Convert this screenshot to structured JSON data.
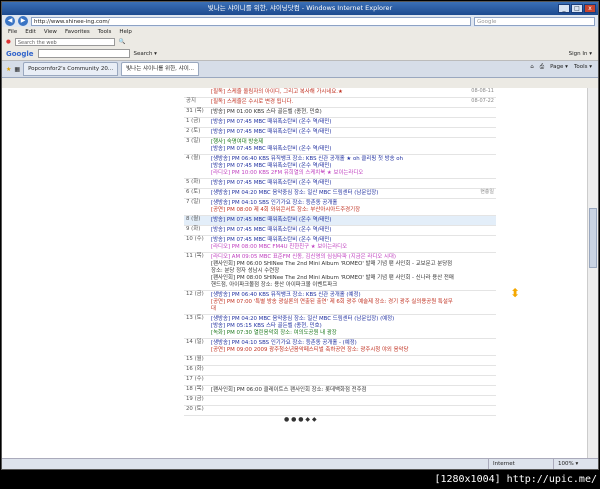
{
  "window": {
    "title": "빛나는 샤이니를 위한, 샤이닝닷컴 - Windows Internet Explorer",
    "controls": [
      "_",
      "□",
      "x"
    ]
  },
  "address": {
    "url": "http://www.shinee-ing.com/",
    "search_placeholder": "Google"
  },
  "menu": [
    "File",
    "Edit",
    "View",
    "Favorites",
    "Tools",
    "Help"
  ],
  "links_bar": {
    "search_placeholder": "Search the web"
  },
  "google_bar": {
    "logo": "Google",
    "search_label": "Search ▾",
    "sign_in": "Sign In ▾"
  },
  "tabs": [
    {
      "label": "Popcornfor2's Community 20..."
    },
    {
      "label": "빛나는 샤이니를 위한, 샤이..."
    }
  ],
  "tab_tools": [
    "Page ▾",
    "Tools ▾"
  ],
  "calendar": {
    "rows": [
      {
        "day": "",
        "events": [
          {
            "text": "[필독] 스케줄 올림자의 아이디, 그리고 복사해 가시네요.★",
            "cls": "ev-r"
          }
        ],
        "right": "08-08-11"
      },
      {
        "day": "공지",
        "events": [
          {
            "text": "[필독] 스케줄은 수시로 변경 됩니다.",
            "cls": "ev-r"
          }
        ],
        "right": "08-07-22"
      },
      {
        "day": "31 (목)",
        "events": [
          {
            "text": "[방송] PM 01:00 KBS 스타 골든벨 (종현, 민호)",
            "cls": "ev-k"
          }
        ],
        "right": ""
      },
      {
        "day": "1 (금)",
        "events": [
          {
            "text": "[방송] PM 07:45 MBC 때워폭소탄비 (온수 역/태민)",
            "cls": "ev-b"
          }
        ],
        "right": ""
      },
      {
        "day": "2 (토)",
        "events": [
          {
            "text": "[방송] PM 07:45 MBC 때워폭소탄비 (온수 역/태민)",
            "cls": "ev-b"
          }
        ],
        "right": ""
      },
      {
        "day": "3 (일)",
        "events": [
          {
            "text": "[행사] 숙명여대 방송제",
            "cls": "ev-g"
          },
          {
            "text": "[방송] PM 07:45 MBC 때워폭소탄비 (온수 역/태민)",
            "cls": "ev-b"
          }
        ],
        "right": ""
      },
      {
        "day": "4 (월)",
        "events": [
          {
            "text": "[생방송] PM 06:40 KBS 뮤직뱅크 장소: KBS 신관 공개홀 ★ oh 클리핑 첫 방송 oh",
            "cls": "ev-b"
          },
          {
            "text": "[방송] PM 07:45 MBC 때워폭소탄비 (온수 역/태민)",
            "cls": "ev-b"
          },
          {
            "text": "[라디오] PM 10:00 KBS 2FM 유희열의 스케치북 ★ 보이는라디오",
            "cls": "ev-p"
          }
        ],
        "right": ""
      },
      {
        "day": "5 (화)",
        "events": [
          {
            "text": "[방송] PM 07:45 MBC 때워폭소탄비 (온수 역/태민)",
            "cls": "ev-b"
          }
        ],
        "right": ""
      },
      {
        "day": "6 (토)",
        "dayCls": "sun",
        "events": [
          {
            "text": "[생방송] PM 04:20 MBC 음악중심 장소: 일산 MBC 드림센터 (남문입장)",
            "cls": "ev-b"
          }
        ],
        "right": "현충일"
      },
      {
        "day": "7 (일)",
        "dayCls": "sun",
        "events": [
          {
            "text": "[생방송] PM 04:10 SBS 인기가요 장소: 등촌동 공개홀",
            "cls": "ev-b"
          },
          {
            "text": "[공연] PM 08:00 제 4회 와워콘서트 장소: 부산아시아드주경기장",
            "cls": "ev-r"
          }
        ],
        "right": ""
      },
      {
        "day": "8 (월)",
        "hl": true,
        "events": [
          {
            "text": "[방송] PM 07:45 MBC 때워폭소탄비 (온수 역/태민)",
            "cls": "ev-b"
          }
        ],
        "right": ""
      },
      {
        "day": "9 (화)",
        "events": [
          {
            "text": "[방송] PM 07:45 MBC 때워폭소탄비 (온수 역/태민)",
            "cls": "ev-b"
          }
        ],
        "right": ""
      },
      {
        "day": "10 (수)",
        "events": [
          {
            "text": "[방송] PM 07:45 MBC 때워폭소탄비 (온수 역/태민)",
            "cls": "ev-b"
          },
          {
            "text": "[라디오] PM 08:00 MBC FM4U 친한친구 ★ 보이는라디오",
            "cls": "ev-p"
          }
        ],
        "right": ""
      },
      {
        "day": "11 (목)",
        "events": [
          {
            "text": "[라디오] AM 09:05 MBC 표준FM 신동, 김신영의 심심타파 (지금은 라디오 시대)",
            "cls": "ev-p"
          },
          {
            "text": "[팬사인회] PM 06:00 SHINee The 2nd Mini Album 'ROMEO' 발매 기념 팬 사인회 - 교보문고 분당점",
            "cls": "ev-k"
          },
          {
            "text": "장소: 분당 정자 성남시 수련장",
            "cls": "ev-k"
          },
          {
            "text": "[팬사인회] PM 08:00 SHINee The 2nd Mini Album 'ROMEO' 발매 기념 팬 사인회 - 신나라 용산 전매",
            "cls": "ev-k"
          },
          {
            "text": "핸드점, 아이파크몰점 장소: 용산 아이파크몰 이벤트파크",
            "cls": "ev-k"
          }
        ],
        "right": ""
      },
      {
        "day": "12 (금)",
        "events": [
          {
            "text": "[생방송] PM 06:40 KBS 뮤직뱅크 장소: KBS 신관 공개홀 (예정)",
            "cls": "ev-b"
          },
          {
            "text": "[공연] PM 07:00 '특별 방송 광실론의 연출된 출연' 제 6회 광주 예술제 장소: 경기 광주 실의용공원 특설무대",
            "cls": "ev-r"
          }
        ],
        "right": ""
      },
      {
        "day": "13 (토)",
        "dayCls": "sat",
        "events": [
          {
            "text": "[생방송] PM 04:20 MBC 음악중심 장소: 일산 MBC 드림센터 (남문입장) (예정)",
            "cls": "ev-b"
          },
          {
            "text": "[방송] PM 05:15 KBS 스타 골든벨 (종현, 민호)",
            "cls": "ev-b"
          },
          {
            "text": "[녹화] PM 07:30 열린음악회 장소: 여의도공원 내 광장",
            "cls": "ev-g"
          }
        ],
        "right": ""
      },
      {
        "day": "14 (일)",
        "dayCls": "sun",
        "events": [
          {
            "text": "[생방송] PM 04:10 SBS 인기가요 장소: 등촌동 공개홀 - (예정)",
            "cls": "ev-b"
          },
          {
            "text": "[공연] PM 09:00 2009 광주청소년음악페스티벌 축하공연 장소: 광주시청 야외 음악당",
            "cls": "ev-r"
          }
        ],
        "right": ""
      },
      {
        "day": "15 (월)",
        "events": [],
        "right": ""
      },
      {
        "day": "16 (화)",
        "events": [],
        "right": ""
      },
      {
        "day": "17 (수)",
        "events": [],
        "right": ""
      },
      {
        "day": "18 (목)",
        "events": [
          {
            "text": "[팬사인회] PM 06:00 클레이트스 팬사인회 장소: 롯데백화점 전주점",
            "cls": "ev-k"
          }
        ],
        "right": ""
      },
      {
        "day": "19 (금)",
        "events": [],
        "right": ""
      },
      {
        "day": "20 (토)",
        "dayCls": "sat",
        "events": [],
        "right": ""
      }
    ],
    "pager": "● ● ● ◆ ◆"
  },
  "status": {
    "zone": "Internet",
    "zoom": "100% ▾"
  },
  "watermark": "[1280x1004] http://upic.me/"
}
